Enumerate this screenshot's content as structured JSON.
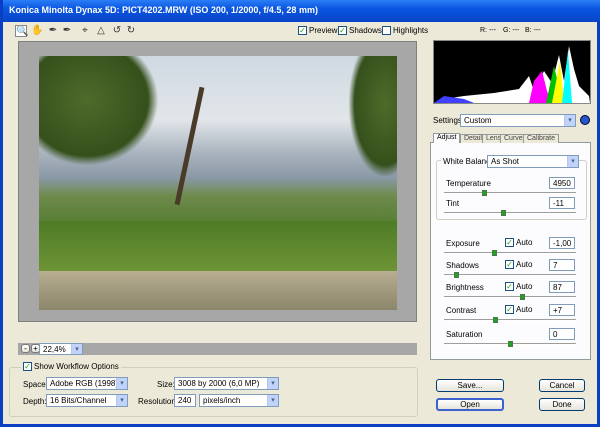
{
  "window": {
    "title": "Konica Minolta Dynax 5D:  PICT4202.MRW  (ISO 200, 1/2000, f/4.5, 28 mm)"
  },
  "toolbar": {
    "tools": [
      "zoom-tool",
      "hand-tool",
      "white-balance-tool",
      "color-sampler-tool",
      "crop-tool",
      "straighten-tool",
      "rotate-left",
      "rotate-right"
    ],
    "preview_label": "Preview",
    "shadows_label": "Shadows",
    "highlights_label": "Highlights",
    "preview": true,
    "shadows": true,
    "highlights": false,
    "r": "R: ---",
    "g": "G: ---",
    "b": "B: ---"
  },
  "zoom": {
    "value": "22,4%",
    "out": "-",
    "in": "+"
  },
  "settings": {
    "label": "Settings:",
    "value": "Custom"
  },
  "tabs": [
    "Adjust",
    "Detail",
    "Lens",
    "Curve",
    "Calibrate"
  ],
  "adjust": {
    "wb_label": "White Balance:",
    "wb_value": "As Shot",
    "temperature": {
      "label": "Temperature",
      "value": "4950",
      "pos": 0.3
    },
    "tint": {
      "label": "Tint",
      "value": "-11",
      "pos": 0.45
    },
    "auto_label": "Auto",
    "exposure": {
      "label": "Exposure",
      "value": "-1,00",
      "pos": 0.38,
      "auto": true
    },
    "shadows": {
      "label": "Shadows",
      "value": "7",
      "pos": 0.09,
      "auto": true
    },
    "brightness": {
      "label": "Brightness",
      "value": "87",
      "pos": 0.59,
      "auto": true
    },
    "contrast": {
      "label": "Contrast",
      "value": "+7",
      "pos": 0.39,
      "auto": true
    },
    "saturation": {
      "label": "Saturation",
      "value": "0",
      "pos": 0.5
    }
  },
  "workflow": {
    "show_label": "Show Workflow Options",
    "show": true,
    "space_label": "Space:",
    "space": "Adobe RGB (1998)",
    "depth_label": "Depth:",
    "depth": "16 Bits/Channel",
    "size_label": "Size:",
    "size": "3008 by 2000  (6,0 MP)",
    "res_label": "Resolution:",
    "resolution": "240",
    "res_unit": "pixels/inch"
  },
  "buttons": {
    "save": "Save...",
    "cancel": "Cancel",
    "open": "Open",
    "done": "Done"
  }
}
